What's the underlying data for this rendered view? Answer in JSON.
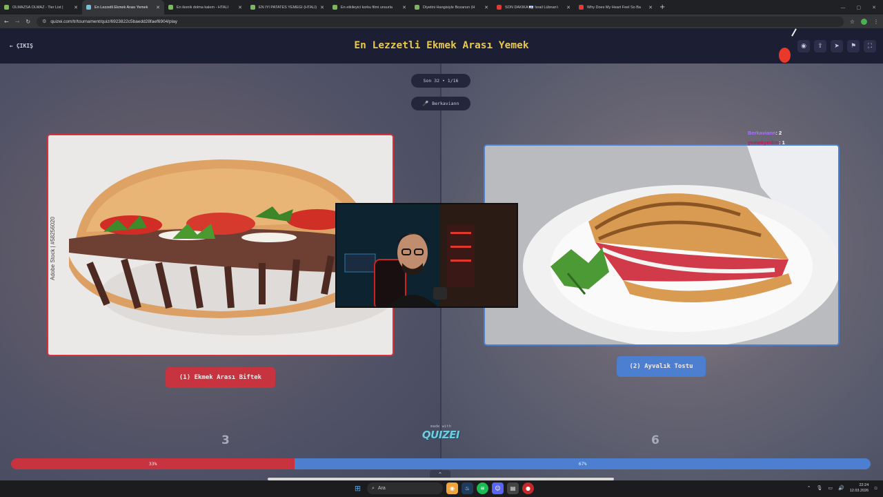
{
  "browser": {
    "tabs": [
      {
        "title": "OLMAZSA OLMAZ - Tier List |",
        "icon": "site-favicon",
        "active": false
      },
      {
        "title": "En Lezzetli Ekmek Arası Yemek",
        "icon": "quizei-favicon",
        "active": true
      },
      {
        "title": "En ikonik dolma kalem - HTALİ",
        "icon": "site-favicon",
        "active": false
      },
      {
        "title": "EN İYİ PATATES YEMEĞİ (HTALİ)",
        "icon": "site-favicon",
        "active": false
      },
      {
        "title": "En etkileyici korku filmi unsurla",
        "icon": "site-favicon",
        "active": false
      },
      {
        "title": "Diyetini Hangisiyle Bozarsın (H",
        "icon": "site-favicon",
        "active": false
      },
      {
        "title": "SON DAKİKA 🇮🇱 İsrail Lübnan'ı",
        "icon": "youtube-favicon",
        "active": false
      },
      {
        "title": "Why Does My Heart Feel So Ba",
        "icon": "youtube-favicon",
        "active": false
      }
    ],
    "url": "quizei.com/tr/tournament/quiz/6923822c5baedd28faef6904/play"
  },
  "header": {
    "exit_label": "ÇIKIŞ",
    "title": "En Lezzetli Ekmek Arası Yemek"
  },
  "round": {
    "label": "Son 32 • 1/16"
  },
  "streamer": {
    "name": "Berkaviann"
  },
  "chat": [
    {
      "user": "Berkaviann",
      "vote": "2",
      "color": "#a971ff"
    },
    {
      "user": "yemekyedim",
      "vote": "1",
      "color": "#c2185b"
    }
  ],
  "options": {
    "left": {
      "label": "(1) Ekmek Arası Biftek",
      "image_watermark": "Adobe Stock | #58256020",
      "votes": "3",
      "percent_label": "33%",
      "percent": 33,
      "color": "#c7333f"
    },
    "right": {
      "label": "(2) Ayvalık Tostu",
      "votes": "6",
      "percent_label": "67%",
      "percent": 67,
      "color": "#4c7fd0"
    }
  },
  "branding": {
    "made_with": "made with",
    "logo": "QUIZEI"
  },
  "taskbar": {
    "search_placeholder": "Ara",
    "time": "22:24",
    "date": "12.03.2026"
  }
}
